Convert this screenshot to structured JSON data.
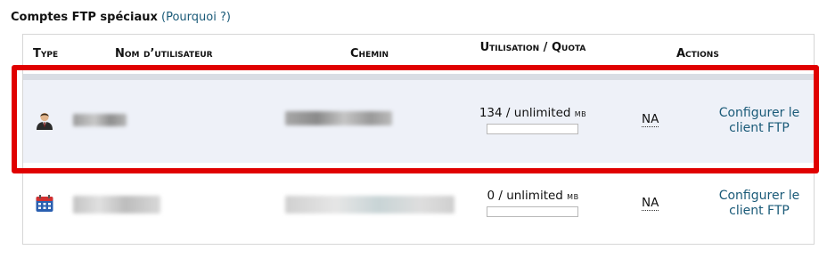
{
  "section": {
    "title": "Comptes FTP spéciaux",
    "help_link": "(Pourquoi ?)"
  },
  "table": {
    "headers": {
      "type": "Type",
      "username": "Nom d’utilisateur",
      "path": "Chemin",
      "usage": "Utilisation / Quota",
      "actions": "Actions"
    },
    "rows": [
      {
        "icon": "user-account-icon",
        "usage_used": "134",
        "usage_separator": "/",
        "usage_quota": "unlimited",
        "usage_unit": "mb",
        "usage_fraction": 0,
        "status": "NA",
        "action_label": "Configurer le client FTP"
      },
      {
        "icon": "calendar-icon",
        "usage_used": "0",
        "usage_separator": "/",
        "usage_quota": "unlimited",
        "usage_unit": "mb",
        "usage_fraction": 0,
        "status": "NA",
        "action_label": "Configurer le client FTP"
      }
    ]
  },
  "colors": {
    "link": "#1a5a78",
    "highlight": "#e00000",
    "row_alt": "#eef1f8"
  }
}
